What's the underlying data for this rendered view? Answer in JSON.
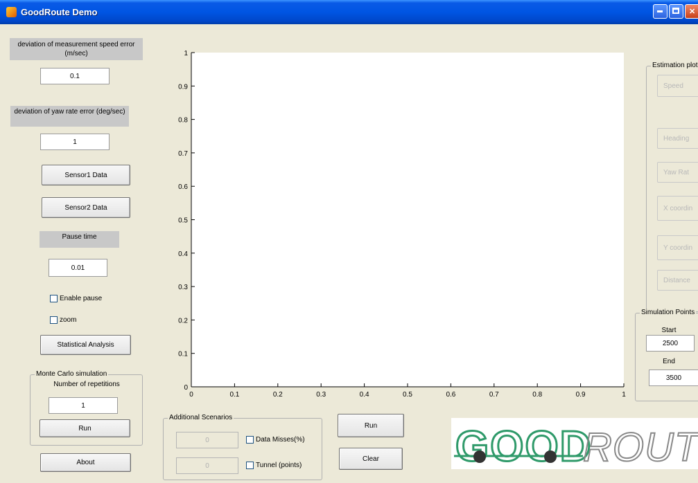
{
  "window": {
    "title": "GoodRoute Demo"
  },
  "left_panel": {
    "speed_error_label": "deviation of measurement speed error (m/sec)",
    "speed_error_value": "0.1",
    "yaw_error_label": "deviation of yaw rate error (deg/sec)",
    "yaw_error_value": "1",
    "sensor1_button": "Sensor1 Data",
    "sensor2_button": "Sensor2 Data",
    "pause_label": "Pause time",
    "pause_value": "0.01",
    "enable_pause": "Enable pause",
    "zoom": "zoom",
    "stats_button": "Statistical Analysis",
    "monte_carlo": {
      "title": "Monte Carlo simulation",
      "repetitions_label": "Number of repetitions",
      "repetitions_value": "1",
      "run_button": "Run"
    },
    "about_button": "About"
  },
  "plot": {
    "chart_data": {
      "type": "line",
      "title": "",
      "xlabel": "",
      "ylabel": "",
      "xlim": [
        0,
        1
      ],
      "ylim": [
        0,
        1
      ],
      "x_ticks": [
        "0",
        "0.1",
        "0.2",
        "0.3",
        "0.4",
        "0.5",
        "0.6",
        "0.7",
        "0.8",
        "0.9",
        "1"
      ],
      "y_ticks": [
        "0",
        "0.1",
        "0.2",
        "0.3",
        "0.4",
        "0.5",
        "0.6",
        "0.7",
        "0.8",
        "0.9",
        "1"
      ],
      "series": [],
      "grid": false
    }
  },
  "scenarios": {
    "title": "Additional Scenarios",
    "data_misses_value": "0",
    "data_misses_label": "Data Misses(%)",
    "tunnel_value": "0",
    "tunnel_label": "Tunnel (points)"
  },
  "actions": {
    "run_button": "Run",
    "clear_button": "Clear"
  },
  "estimation_plots": {
    "title": "Estimation plot",
    "buttons": [
      "Speed",
      "Heading",
      "Yaw Rat",
      "X coordin",
      "Y coordin",
      "Distance"
    ]
  },
  "simulation_points": {
    "title": "Simulation Points",
    "start_label": "Start",
    "start_value": "2500",
    "end_label": "End",
    "end_value": "3500"
  },
  "logo": {
    "text_left": "GOOD",
    "text_right": "ROUTE"
  }
}
